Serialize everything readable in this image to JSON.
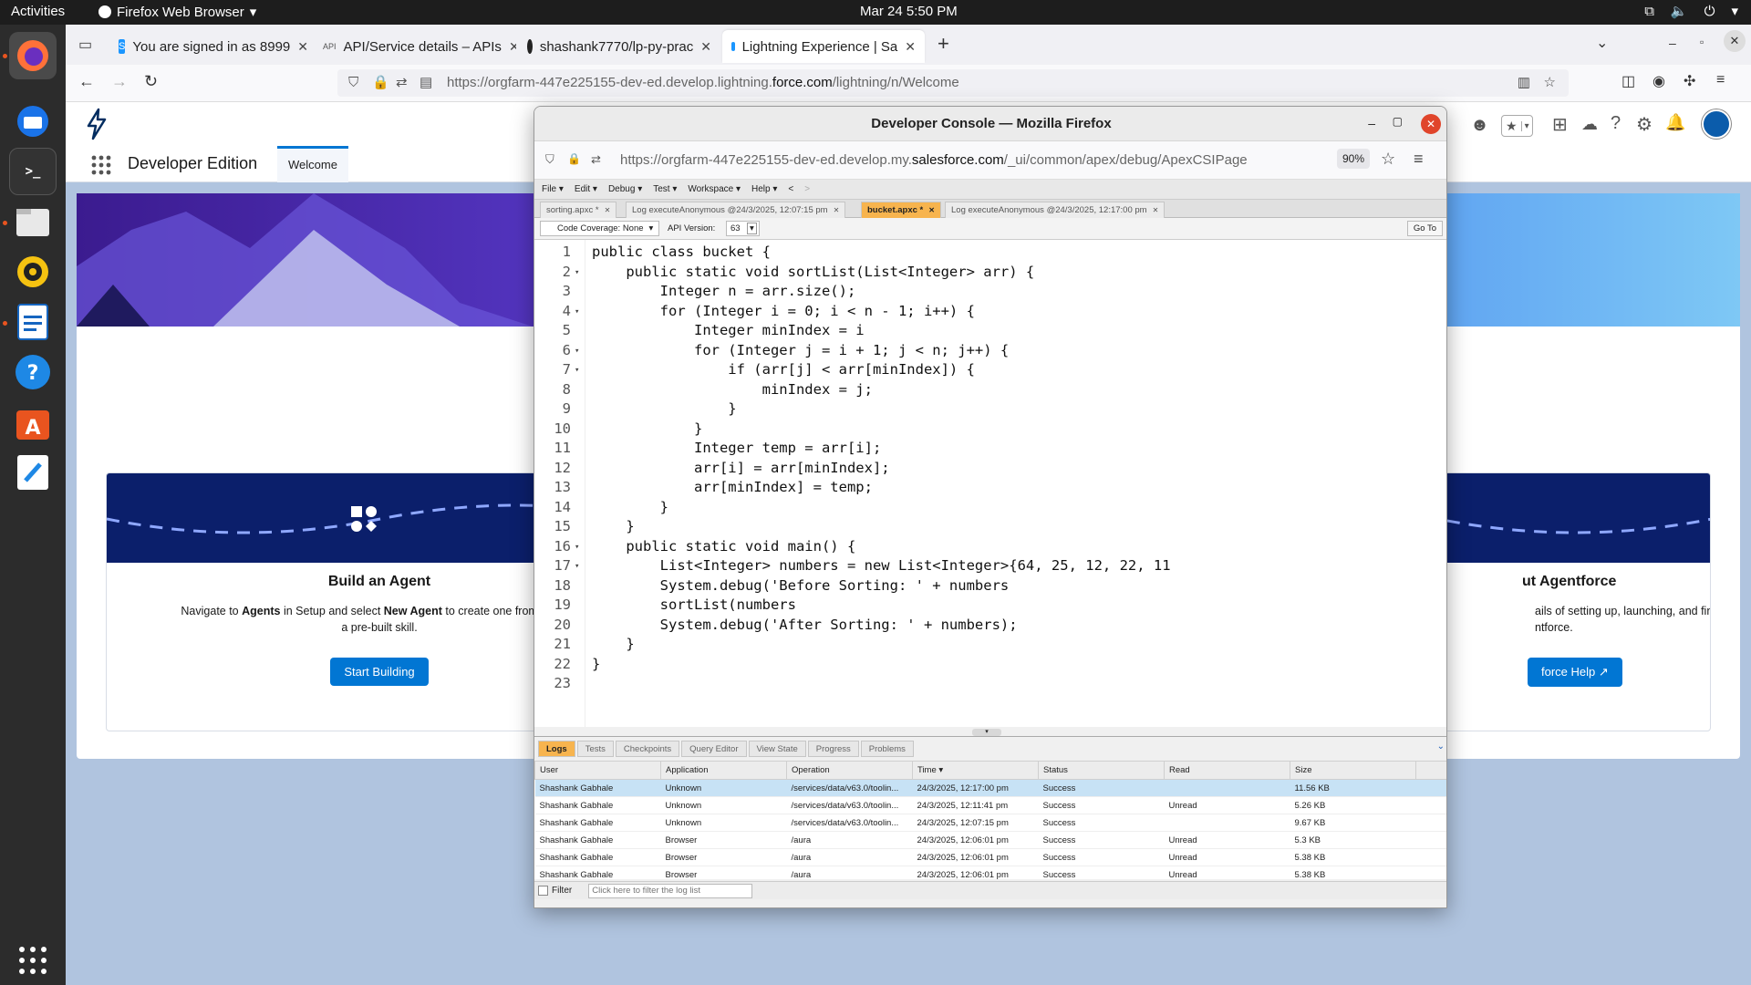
{
  "os": {
    "activities": "Activities",
    "app_name": "Firefox Web Browser",
    "clock": "Mar 24  5:50 PM"
  },
  "browser": {
    "tabs": [
      {
        "label": "You are signed in as 8999"
      },
      {
        "label": "API/Service details – APIs"
      },
      {
        "label": "shashank7770/lp-py-prac"
      },
      {
        "label": "Lightning Experience | Sa"
      }
    ],
    "url_prefix": "https://orgfarm-447e225155-dev-ed.develop.lightning.",
    "url_domain": "force.com",
    "url_suffix": "/lightning/n/Welcome"
  },
  "salesforce": {
    "app_name": "Developer Edition",
    "tab_welcome": "Welcome",
    "card1": {
      "title": "Build an Agent",
      "desc_1": "Navigate to ",
      "desc_2": "Agents",
      "desc_3": " in Setup and select ",
      "desc_4": "New Agent",
      "desc_5": " to create one from scratch",
      "desc_6": "a pre-built skill.",
      "button": "Start Building"
    },
    "card2": {
      "title": "ut Agentforce",
      "desc": "ails of setting up, launching, and fine-tuning",
      "desc2": "ntforce.",
      "button": "force Help"
    }
  },
  "console": {
    "window_title": "Developer Console — Mozilla Firefox",
    "url_prefix": "https://orgfarm-447e225155-dev-ed.develop.my.",
    "url_domain": "salesforce.com",
    "url_suffix": "/_ui/common/apex/debug/ApexCSIPage",
    "zoom": "90%",
    "menu": [
      "File ▾",
      "Edit ▾",
      "Debug ▾",
      "Test ▾",
      "Workspace ▾",
      "Help ▾",
      "<",
      ">"
    ],
    "tabs": [
      {
        "label": "sorting.apxc *"
      },
      {
        "label": "Log executeAnonymous @24/3/2025, 12:07:15 pm"
      },
      {
        "label": "bucket.apxc *"
      },
      {
        "label": "Log executeAnonymous @24/3/2025, 12:17:00 pm"
      }
    ],
    "code_coverage": "Code Coverage: None",
    "api_version_label": "API Version:",
    "api_version": "63",
    "go_to": "Go To",
    "code_lines": [
      "public class bucket {",
      "    public static void sortList(List<Integer> arr) {",
      "        Integer n = arr.size();",
      "        for (Integer i = 0; i < n - 1; i++) {",
      "            Integer minIndex = i",
      "            for (Integer j = i + 1; j < n; j++) {",
      "                if (arr[j] < arr[minIndex]) {",
      "                    minIndex = j;",
      "                }",
      "            }",
      "            Integer temp = arr[i];",
      "            arr[i] = arr[minIndex];",
      "            arr[minIndex] = temp;",
      "        }",
      "    }",
      "    public static void main() {",
      "        List<Integer> numbers = new List<Integer>{64, 25, 12, 22, 11",
      "        System.debug('Before Sorting: ' + numbers",
      "        sortList(numbers",
      "        System.debug('After Sorting: ' + numbers);",
      "    }",
      "}",
      ""
    ],
    "fold_lines": [
      2,
      4,
      6,
      7,
      16,
      17
    ],
    "log_tabs": [
      "Logs",
      "Tests",
      "Checkpoints",
      "Query Editor",
      "View State",
      "Progress",
      "Problems"
    ],
    "log_columns": [
      "User",
      "Application",
      "Operation",
      "Time ▾",
      "Status",
      "Read",
      "Size"
    ],
    "log_rows": [
      [
        "Shashank Gabhale",
        "Unknown",
        "/services/data/v63.0/toolin...",
        "24/3/2025, 12:17:00 pm",
        "Success",
        "",
        "11.56 KB"
      ],
      [
        "Shashank Gabhale",
        "Unknown",
        "/services/data/v63.0/toolin...",
        "24/3/2025, 12:11:41 pm",
        "Success",
        "Unread",
        "5.26 KB"
      ],
      [
        "Shashank Gabhale",
        "Unknown",
        "/services/data/v63.0/toolin...",
        "24/3/2025, 12:07:15 pm",
        "Success",
        "",
        "9.67 KB"
      ],
      [
        "Shashank Gabhale",
        "Browser",
        "/aura",
        "24/3/2025, 12:06:01 pm",
        "Success",
        "Unread",
        "5.3 KB"
      ],
      [
        "Shashank Gabhale",
        "Browser",
        "/aura",
        "24/3/2025, 12:06:01 pm",
        "Success",
        "Unread",
        "5.38 KB"
      ],
      [
        "Shashank Gabhale",
        "Browser",
        "/aura",
        "24/3/2025, 12:06:01 pm",
        "Success",
        "Unread",
        "5.38 KB"
      ]
    ],
    "filter_label": "Filter",
    "filter_placeholder": "Click here to filter the log list"
  }
}
